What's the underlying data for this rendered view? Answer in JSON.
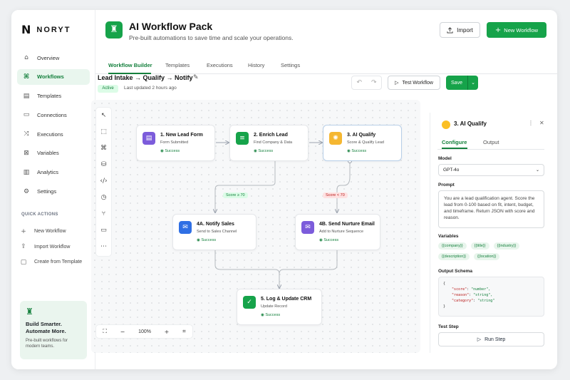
{
  "brand": {
    "name": "NORYT",
    "mark": "N"
  },
  "sidebar": {
    "items": [
      {
        "label": "Overview",
        "icon": "home-icon",
        "glyph": "⌂",
        "active": false
      },
      {
        "label": "Workflows",
        "icon": "workflow-icon",
        "glyph": "⌘",
        "active": true
      },
      {
        "label": "Templates",
        "icon": "templates-icon",
        "glyph": "▤",
        "active": false
      },
      {
        "label": "Connections",
        "icon": "connections-icon",
        "glyph": "▭",
        "active": false
      },
      {
        "label": "Executions",
        "icon": "executions-icon",
        "glyph": "⤨",
        "active": false
      },
      {
        "label": "Variables",
        "icon": "variables-icon",
        "glyph": "⊠",
        "active": false
      },
      {
        "label": "Analytics",
        "icon": "analytics-icon",
        "glyph": "▥",
        "active": false
      },
      {
        "label": "Settings",
        "icon": "settings-icon",
        "glyph": "⚙",
        "active": false
      }
    ],
    "quick_actions_title": "QUICK ACTIONS",
    "quick_actions": [
      {
        "label": "New Workflow",
        "icon": "plus-icon",
        "glyph": "+"
      },
      {
        "label": "Import Workflow",
        "icon": "import-icon",
        "glyph": "⇪"
      },
      {
        "label": "Create from Template",
        "icon": "template-icon",
        "glyph": "▢"
      }
    ],
    "promo": {
      "title": "Build Smarter. Automate More.",
      "subtitle": "Pre-built workflows for modern teams."
    }
  },
  "header": {
    "title": "AI Workflow Pack",
    "subtitle": "Pre-built automations to save time and scale your operations.",
    "import_label": "Import",
    "new_workflow_label": "New Workflow"
  },
  "tabs": [
    "Workflow Builder",
    "Templates",
    "Executions",
    "History",
    "Settings"
  ],
  "workflow": {
    "title": "Lead Intake → Qualify → Notify",
    "status": "Active",
    "last_updated": "Last updated 2 hours ago",
    "test_label": "Test Workflow",
    "save_label": "Save"
  },
  "canvas": {
    "zoom": "100%",
    "nodes": [
      {
        "title": "1. New Lead Form",
        "subtitle": "Form Submitted",
        "status": "Success",
        "color": "#7c5cdb",
        "icon": "form-icon",
        "glyph": "▤"
      },
      {
        "title": "2. Enrich Lead",
        "subtitle": "Find Company & Data",
        "status": "Success",
        "color": "#16a34a",
        "icon": "database-icon",
        "glyph": "≡"
      },
      {
        "title": "3. AI Qualify",
        "subtitle": "Score & Qualify Lead",
        "status": "Success",
        "color": "#f5b731",
        "icon": "brain-icon",
        "glyph": "✺"
      },
      {
        "title": "4A. Notify Sales",
        "subtitle": "Send to Sales Channel",
        "status": "Success",
        "color": "#2f6fe4",
        "icon": "mail-icon",
        "glyph": "✉"
      },
      {
        "title": "4B. Send Nurture Email",
        "subtitle": "Add to Nurture Sequence",
        "status": "Success",
        "color": "#7c5cdb",
        "icon": "mail-icon",
        "glyph": "✉"
      },
      {
        "title": "5. Log & Update CRM",
        "subtitle": "Update Record",
        "status": "Success",
        "color": "#16a34a",
        "icon": "check-icon",
        "glyph": "✓"
      }
    ],
    "edge_labels": {
      "high": "Score ≥ 70",
      "low": "Score < 70"
    }
  },
  "panel": {
    "title": "3. AI Qualify",
    "tabs": [
      "Configure",
      "Output"
    ],
    "model_label": "Model",
    "model_value": "GPT-4o",
    "prompt_label": "Prompt",
    "prompt_text": "You are a lead qualification agent. Score the lead from 0-100 based on fit, intent, budget, and timeframe. Return JSON with score and reason.",
    "variables_label": "Variables",
    "variables": [
      "{{company}}",
      "{{title}}",
      "{{industry}}",
      "{{description}}",
      "{{location}}"
    ],
    "schema_label": "Output Schema",
    "schema": {
      "open": "{",
      "lines": [
        {
          "key": "\"score\"",
          "value": "\"number\","
        },
        {
          "key": "\"reason\"",
          "value": "\"string\","
        },
        {
          "key": "\"category\"",
          "value": "\"string\""
        }
      ],
      "close": "}"
    },
    "test_label": "Test Step",
    "run_label": "Run Step"
  },
  "colors": {
    "accent": "#16a34a",
    "accent_dark": "#15803d"
  }
}
